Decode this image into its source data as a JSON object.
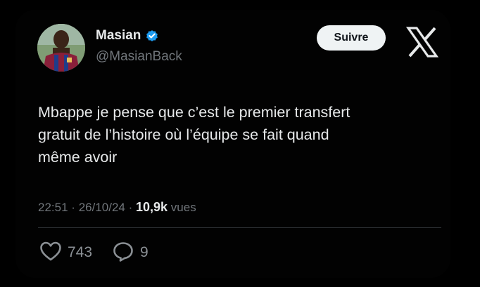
{
  "author": {
    "display_name": "Masian",
    "handle": "@MasianBack",
    "verified": true,
    "avatar_icon": "avatar-photo"
  },
  "follow_button": {
    "label": "Suivre"
  },
  "brand": {
    "logo_icon": "x-logo-icon"
  },
  "tweet": {
    "text": "Mbappe je pense que c’est le premier transfert\ngratuit de l’histoire où l’équipe se fait quand\nmême avoir"
  },
  "meta": {
    "time": "22:51",
    "separator": "·",
    "date": "26/10/24",
    "views_count": "10,9k",
    "views_label": "vues"
  },
  "actions": {
    "likes": "743",
    "replies": "9"
  },
  "colors": {
    "background": "#000000",
    "text_primary": "#e7e9ea",
    "text_secondary": "#71767b",
    "verified_blue": "#1d9bf0",
    "button_bg": "#eff3f4",
    "divider": "#2f3336"
  }
}
